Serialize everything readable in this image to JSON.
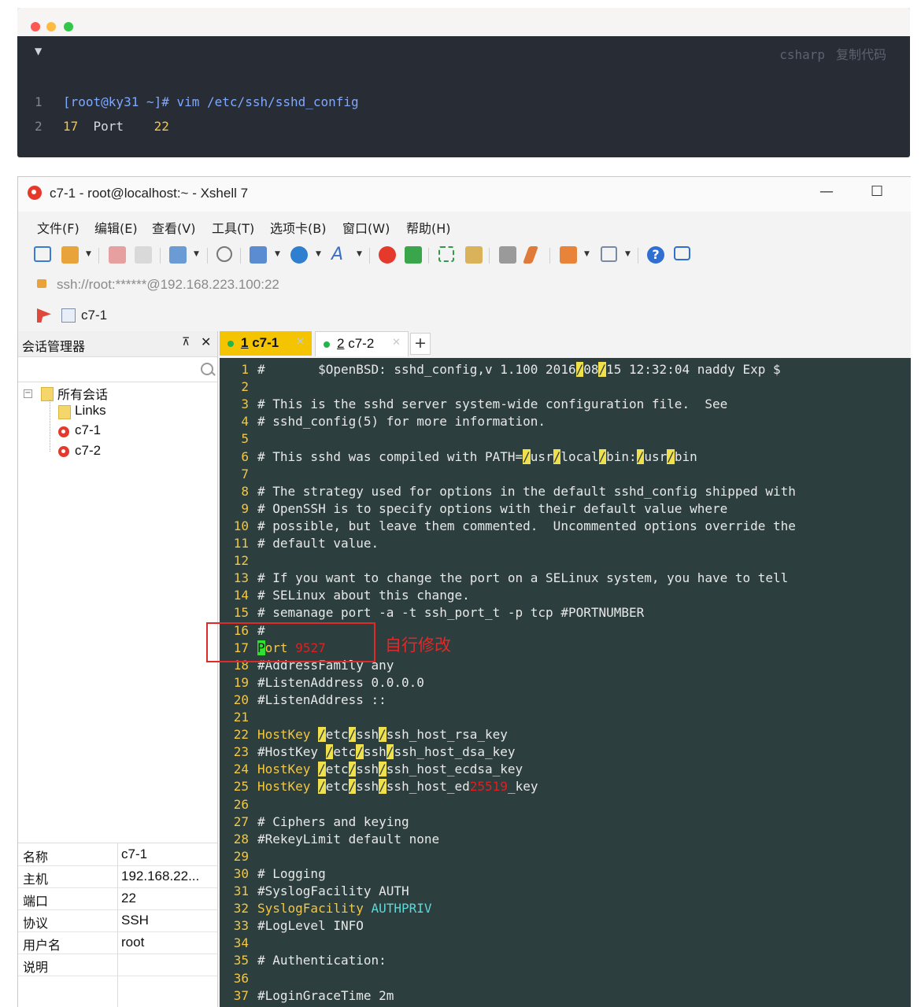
{
  "code_block": {
    "lang": "csharp",
    "copy": "复制代码",
    "lines": [
      {
        "n": "1",
        "parts": [
          [
            "[root@ky31 ~]# vim /etc/ssh/sshd_config",
            "#7fa8ff"
          ]
        ]
      },
      {
        "n": "2",
        "parts": [
          [
            "17",
            "#f2c744"
          ],
          [
            "  Port    ",
            "#d7dae0"
          ],
          [
            "22",
            "#f2c744"
          ]
        ]
      }
    ]
  },
  "window": {
    "title": "c7-1 - root@localhost:~ - Xshell 7",
    "minimize": "—",
    "maximize": "☐"
  },
  "menu": [
    "文件(F)",
    "编辑(E)",
    "查看(V)",
    "工具(T)",
    "选项卡(B)",
    "窗口(W)",
    "帮助(H)"
  ],
  "address": "ssh://root:******@192.168.223.100:22",
  "quick_bar": {
    "label": "c7-1"
  },
  "session_manager": {
    "title": "会话管理器",
    "pin": "⊼",
    "close": "✕",
    "tree": {
      "root": "所有会话",
      "items": [
        "Links",
        "c7-1",
        "c7-2"
      ]
    },
    "props": [
      {
        "k": "名称",
        "v": "c7-1"
      },
      {
        "k": "主机",
        "v": "192.168.22..."
      },
      {
        "k": "端口",
        "v": "22"
      },
      {
        "k": "协议",
        "v": "SSH"
      },
      {
        "k": "用户名",
        "v": "root"
      },
      {
        "k": "说明",
        "v": ""
      }
    ]
  },
  "tabs": [
    {
      "num": "1",
      "label": "c7-1"
    },
    {
      "num": "2",
      "label": "c7-2"
    }
  ],
  "tab_plus": "+",
  "terminal_lines": [
    {
      "n": "1",
      "parts": [
        [
          "#       $OpenBSD: sshd_config,v 1.100 2016",
          ""
        ],
        [
          "/",
          "hl"
        ],
        [
          "08",
          ""
        ],
        [
          "/",
          "hl"
        ],
        [
          "15 12:32:04 naddy Exp $",
          ""
        ]
      ]
    },
    {
      "n": "2",
      "parts": []
    },
    {
      "n": "3",
      "parts": [
        [
          "# This is the sshd server system-wide configuration file.  See",
          ""
        ]
      ]
    },
    {
      "n": "4",
      "parts": [
        [
          "# sshd_config(5) for more information.",
          ""
        ]
      ]
    },
    {
      "n": "5",
      "parts": []
    },
    {
      "n": "6",
      "parts": [
        [
          "# This sshd was compiled with PATH=",
          ""
        ],
        [
          "/",
          "hl"
        ],
        [
          "usr",
          ""
        ],
        [
          "/",
          "hl"
        ],
        [
          "local",
          ""
        ],
        [
          "/",
          "hl"
        ],
        [
          "bin:",
          ""
        ],
        [
          "/",
          "hl"
        ],
        [
          "usr",
          ""
        ],
        [
          "/",
          "hl"
        ],
        [
          "bin",
          ""
        ]
      ]
    },
    {
      "n": "7",
      "parts": []
    },
    {
      "n": "8",
      "parts": [
        [
          "# The strategy used for options in the default sshd_config shipped with",
          ""
        ]
      ]
    },
    {
      "n": "9",
      "parts": [
        [
          "# OpenSSH is to specify options with their default value where",
          ""
        ]
      ]
    },
    {
      "n": "10",
      "parts": [
        [
          "# possible, but leave them commented.  Uncommented options override the",
          ""
        ]
      ]
    },
    {
      "n": "11",
      "parts": [
        [
          "# default value.",
          ""
        ]
      ]
    },
    {
      "n": "12",
      "parts": []
    },
    {
      "n": "13",
      "parts": [
        [
          "# If you want to change the port on a SELinux system, you have to tell",
          ""
        ]
      ]
    },
    {
      "n": "14",
      "parts": [
        [
          "# SELinux about this change.",
          ""
        ]
      ]
    },
    {
      "n": "15",
      "parts": [
        [
          "# semanage port -a -t ssh_port_t -p tcp #PORTNUMBER",
          ""
        ]
      ]
    },
    {
      "n": "16",
      "parts": [
        [
          "#",
          ""
        ]
      ]
    },
    {
      "n": "17",
      "parts": [
        [
          "P",
          "grn"
        ],
        [
          "ort ",
          "yel"
        ],
        [
          "9527",
          "red"
        ]
      ]
    },
    {
      "n": "18",
      "parts": [
        [
          "#AddressFamily any",
          ""
        ]
      ]
    },
    {
      "n": "19",
      "parts": [
        [
          "#ListenAddress 0.0.0.0",
          ""
        ]
      ]
    },
    {
      "n": "20",
      "parts": [
        [
          "#ListenAddress ::",
          ""
        ]
      ]
    },
    {
      "n": "21",
      "parts": []
    },
    {
      "n": "22",
      "parts": [
        [
          "HostKey ",
          "yel"
        ],
        [
          "/",
          "hl"
        ],
        [
          "etc",
          ""
        ],
        [
          "/",
          "hl"
        ],
        [
          "ssh",
          ""
        ],
        [
          "/",
          "hl"
        ],
        [
          "ssh_host_rsa_key",
          ""
        ]
      ]
    },
    {
      "n": "23",
      "parts": [
        [
          "#HostKey ",
          ""
        ],
        [
          "/",
          "hl"
        ],
        [
          "etc",
          ""
        ],
        [
          "/",
          "hl"
        ],
        [
          "ssh",
          ""
        ],
        [
          "/",
          "hl"
        ],
        [
          "ssh_host_dsa_key",
          ""
        ]
      ]
    },
    {
      "n": "24",
      "parts": [
        [
          "HostKey ",
          "yel"
        ],
        [
          "/",
          "hl"
        ],
        [
          "etc",
          ""
        ],
        [
          "/",
          "hl"
        ],
        [
          "ssh",
          ""
        ],
        [
          "/",
          "hl"
        ],
        [
          "ssh_host_ecdsa_key",
          ""
        ]
      ]
    },
    {
      "n": "25",
      "parts": [
        [
          "HostKey ",
          "yel"
        ],
        [
          "/",
          "hl"
        ],
        [
          "etc",
          ""
        ],
        [
          "/",
          "hl"
        ],
        [
          "ssh",
          ""
        ],
        [
          "/",
          "hl"
        ],
        [
          "ssh_host_ed",
          ""
        ],
        [
          "25519",
          "red"
        ],
        [
          "_key",
          ""
        ]
      ]
    },
    {
      "n": "26",
      "parts": []
    },
    {
      "n": "27",
      "parts": [
        [
          "# Ciphers and keying",
          ""
        ]
      ]
    },
    {
      "n": "28",
      "parts": [
        [
          "#RekeyLimit default none",
          ""
        ]
      ]
    },
    {
      "n": "29",
      "parts": []
    },
    {
      "n": "30",
      "parts": [
        [
          "# Logging",
          ""
        ]
      ]
    },
    {
      "n": "31",
      "parts": [
        [
          "#SyslogFacility AUTH",
          ""
        ]
      ]
    },
    {
      "n": "32",
      "parts": [
        [
          "SyslogFacility ",
          "yel"
        ],
        [
          "AUTHPRIV",
          "cyn"
        ]
      ]
    },
    {
      "n": "33",
      "parts": [
        [
          "#LogLevel INFO",
          ""
        ]
      ]
    },
    {
      "n": "34",
      "parts": []
    },
    {
      "n": "35",
      "parts": [
        [
          "# Authentication:",
          ""
        ]
      ]
    },
    {
      "n": "36",
      "parts": []
    },
    {
      "n": "37",
      "parts": [
        [
          "#LoginGraceTime 2m",
          ""
        ]
      ]
    }
  ],
  "annotation": "自行修改"
}
